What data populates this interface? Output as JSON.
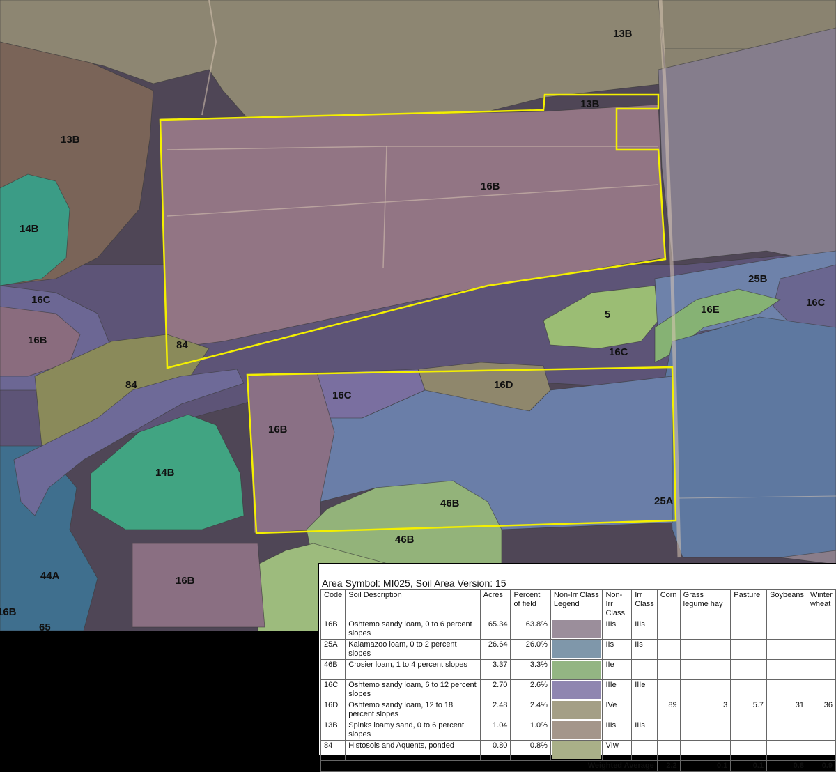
{
  "colors": {
    "bg_dark": "#3f3b48",
    "unit_13B": "#8c7d66",
    "unit_16B": "#8a6f7e",
    "unit_16C": "#6f6a9a",
    "unit_16D": "#8f8870",
    "unit_16E": "#8fb27a",
    "unit_14B": "#3fa88a",
    "unit_25A": "#5f7ea6",
    "unit_25B": "#6a7fa8",
    "unit_46B": "#8faf6f",
    "unit_5": "#9bc07a",
    "unit_84": "#8c8f5f",
    "unit_44A": "#3f6a8a",
    "boundary_yellow": "#f4f000"
  },
  "map_labels": [
    {
      "name": "13B",
      "text": "13B"
    },
    {
      "name": "13B",
      "text": "13B"
    },
    {
      "name": "13B",
      "text": "13B"
    },
    {
      "name": "16B",
      "text": "16B"
    },
    {
      "name": "14B",
      "text": "14B"
    },
    {
      "name": "16C",
      "text": "16C"
    },
    {
      "name": "16B",
      "text": "16B"
    },
    {
      "name": "84",
      "text": "84"
    },
    {
      "name": "84",
      "text": "84"
    },
    {
      "name": "5",
      "text": "5"
    },
    {
      "name": "25B",
      "text": "25B"
    },
    {
      "name": "16E",
      "text": "16E"
    },
    {
      "name": "16C",
      "text": "16C"
    },
    {
      "name": "16C",
      "text": "16C"
    },
    {
      "name": "16D",
      "text": "16D"
    },
    {
      "name": "16C",
      "text": "16C"
    },
    {
      "name": "16B",
      "text": "16B"
    },
    {
      "name": "14B",
      "text": "14B"
    },
    {
      "name": "46B",
      "text": "46B"
    },
    {
      "name": "25A",
      "text": "25A"
    },
    {
      "name": "46B",
      "text": "46B"
    },
    {
      "name": "44A",
      "text": "44A"
    },
    {
      "name": "16B",
      "text": "16B"
    },
    {
      "name": "16B",
      "text": "16B"
    },
    {
      "name": "65",
      "text": "65"
    }
  ],
  "legend": {
    "title": "Area Symbol: MI025, Soil Area Version: 15",
    "headers": {
      "code": "Code",
      "desc": "Soil Description",
      "acres": "Acres",
      "pct": "Percent of field",
      "legend": "Non-Irr Class Legend",
      "nonirr": "Non-Irr Class",
      "irr": "Irr Class",
      "corn": "Corn",
      "grass": "Grass legume hay",
      "pasture": "Pasture",
      "soy": "Soybeans",
      "wheat": "Winter wheat"
    },
    "rows": [
      {
        "code": "16B",
        "desc": "Oshtemo sandy loam, 0 to 6 percent slopes",
        "acres": "65.34",
        "pct": "63.8%",
        "swatch": "#9b8e9b",
        "nonirr": "IIIs",
        "irr": "IIIs",
        "corn": "",
        "grass": "",
        "pasture": "",
        "soy": "",
        "wheat": ""
      },
      {
        "code": "25A",
        "desc": "Kalamazoo loam, 0 to 2 percent slopes",
        "acres": "26.64",
        "pct": "26.0%",
        "swatch": "#7f97aa",
        "nonirr": "IIs",
        "irr": "IIs",
        "corn": "",
        "grass": "",
        "pasture": "",
        "soy": "",
        "wheat": ""
      },
      {
        "code": "46B",
        "desc": "Crosier loam, 1 to 4 percent slopes",
        "acres": "3.37",
        "pct": "3.3%",
        "swatch": "#93b583",
        "nonirr": "IIe",
        "irr": "",
        "corn": "",
        "grass": "",
        "pasture": "",
        "soy": "",
        "wheat": ""
      },
      {
        "code": "16C",
        "desc": "Oshtemo sandy loam, 6 to 12 percent slopes",
        "acres": "2.70",
        "pct": "2.6%",
        "swatch": "#8f86b0",
        "nonirr": "IIIe",
        "irr": "IIIe",
        "corn": "",
        "grass": "",
        "pasture": "",
        "soy": "",
        "wheat": ""
      },
      {
        "code": "16D",
        "desc": "Oshtemo sandy loam, 12 to 18 percent slopes",
        "acres": "2.48",
        "pct": "2.4%",
        "swatch": "#a49f86",
        "nonirr": "IVe",
        "irr": "",
        "corn": "89",
        "grass": "3",
        "pasture": "5.7",
        "soy": "31",
        "wheat": "36"
      },
      {
        "code": "13B",
        "desc": "Spinks loamy sand, 0 to 6 percent slopes",
        "acres": "1.04",
        "pct": "1.0%",
        "swatch": "#a4968a",
        "nonirr": "IIIs",
        "irr": "IIIs",
        "corn": "",
        "grass": "",
        "pasture": "",
        "soy": "",
        "wheat": ""
      },
      {
        "code": "84",
        "desc": "Histosols and Aquents, ponded",
        "acres": "0.80",
        "pct": "0.8%",
        "swatch": "#a9b088",
        "nonirr": "VIw",
        "irr": "",
        "corn": "",
        "grass": "",
        "pasture": "",
        "soy": "",
        "wheat": ""
      }
    ],
    "weighted": {
      "label": "Weighted Average",
      "corn": "2.2",
      "grass": "0.1",
      "pasture": "0.1",
      "soy": "0.8",
      "wheat": "0.9"
    }
  }
}
